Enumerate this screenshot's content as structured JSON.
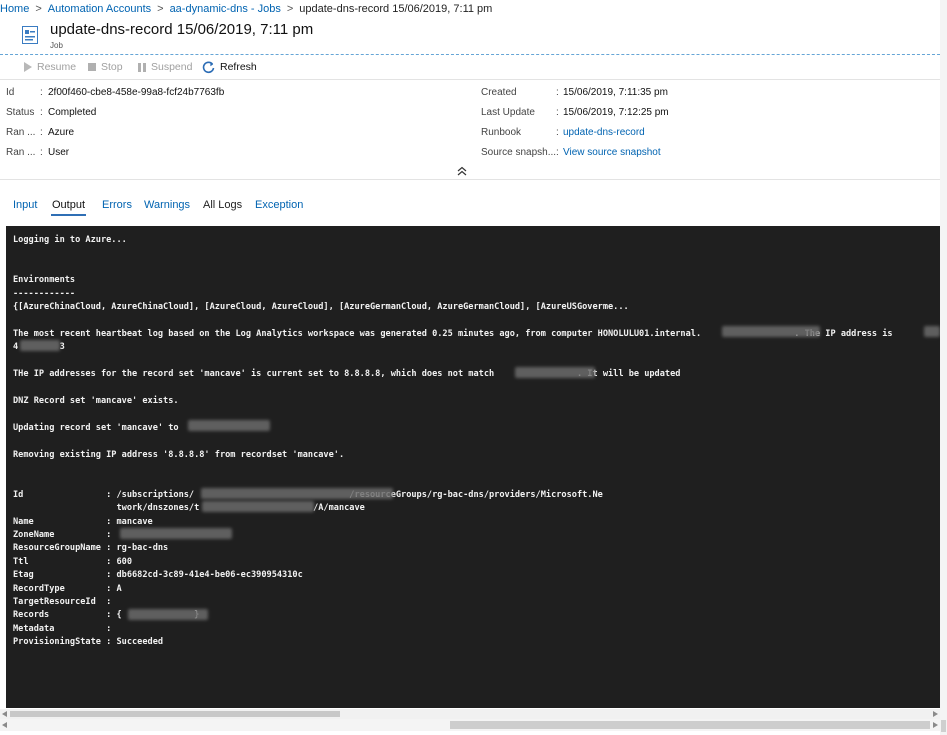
{
  "breadcrumb": {
    "items": [
      "Home",
      "Automation Accounts",
      "aa-dynamic-dns - Jobs"
    ],
    "current": "update-dns-record 15/06/2019, 7:11 pm"
  },
  "header": {
    "title": "update-dns-record 15/06/2019, 7:11 pm",
    "subtitle": "Job",
    "icon": "job-icon"
  },
  "toolbar": {
    "resume": "Resume",
    "stop": "Stop",
    "suspend": "Suspend",
    "refresh": "Refresh"
  },
  "essentials": {
    "left": [
      {
        "key": "Id",
        "value": "2f00f460-cbe8-458e-99a8-fcf24b7763fb"
      },
      {
        "key": "Status",
        "value": "Completed"
      },
      {
        "key": "Ran ...",
        "value": "Azure"
      },
      {
        "key": "Ran ...",
        "value": "User"
      }
    ],
    "right": [
      {
        "key": "Created",
        "value": "15/06/2019, 7:11:35 pm"
      },
      {
        "key": "Last Update",
        "value": "15/06/2019, 7:12:25 pm"
      },
      {
        "key": "Runbook",
        "value": "update-dns-record"
      },
      {
        "key": "Source snapsh...",
        "value": "View source snapshot"
      }
    ]
  },
  "tabs": [
    "Input",
    "Output",
    "Errors",
    "Warnings",
    "All Logs",
    "Exception"
  ],
  "selected_tab": "Output",
  "console": {
    "lines": [
      "Logging in to Azure...",
      "",
      "",
      "Environments",
      "------------",
      "{[AzureChinaCloud, AzureChinaCloud], [AzureCloud, AzureCloud], [AzureGermanCloud, AzureGermanCloud], [AzureUSGoverme...",
      "",
      "The most recent heartbeat log based on the Log Analytics workspace was generated 0.25 minutes ago, from computer HONOLULU01.internal.                  . The IP address is",
      "4        3",
      "",
      "THe IP addresses for the record set 'mancave' is current set to 8.8.8.8, which does not match                . It will be updated",
      "",
      "DNZ Record set 'mancave' exists.",
      "",
      "Updating record set 'mancave' to",
      "",
      "Removing existing IP address '8.8.8.8' from recordset 'mancave'.",
      "",
      "",
      "Id                : /subscriptions/                              /resourceGroups/rg-bac-dns/providers/Microsoft.Ne",
      "                    twork/dnszones/t                      /A/mancave",
      "Name              : mancave",
      "ZoneName          :",
      "ResourceGroupName : rg-bac-dns",
      "Ttl               : 600",
      "Etag              : db6682cd-3c89-41e4-be06-ec390954310c",
      "RecordType        : A",
      "TargetResourceId  :",
      "Records           : {              }",
      "Metadata          :",
      "ProvisioningState : Succeeded"
    ]
  },
  "colors": {
    "link": "#0063b1",
    "console_bg": "#1f1f1f",
    "console_text": "#f2f2f2",
    "tab_underline": "#2f6fb5"
  }
}
